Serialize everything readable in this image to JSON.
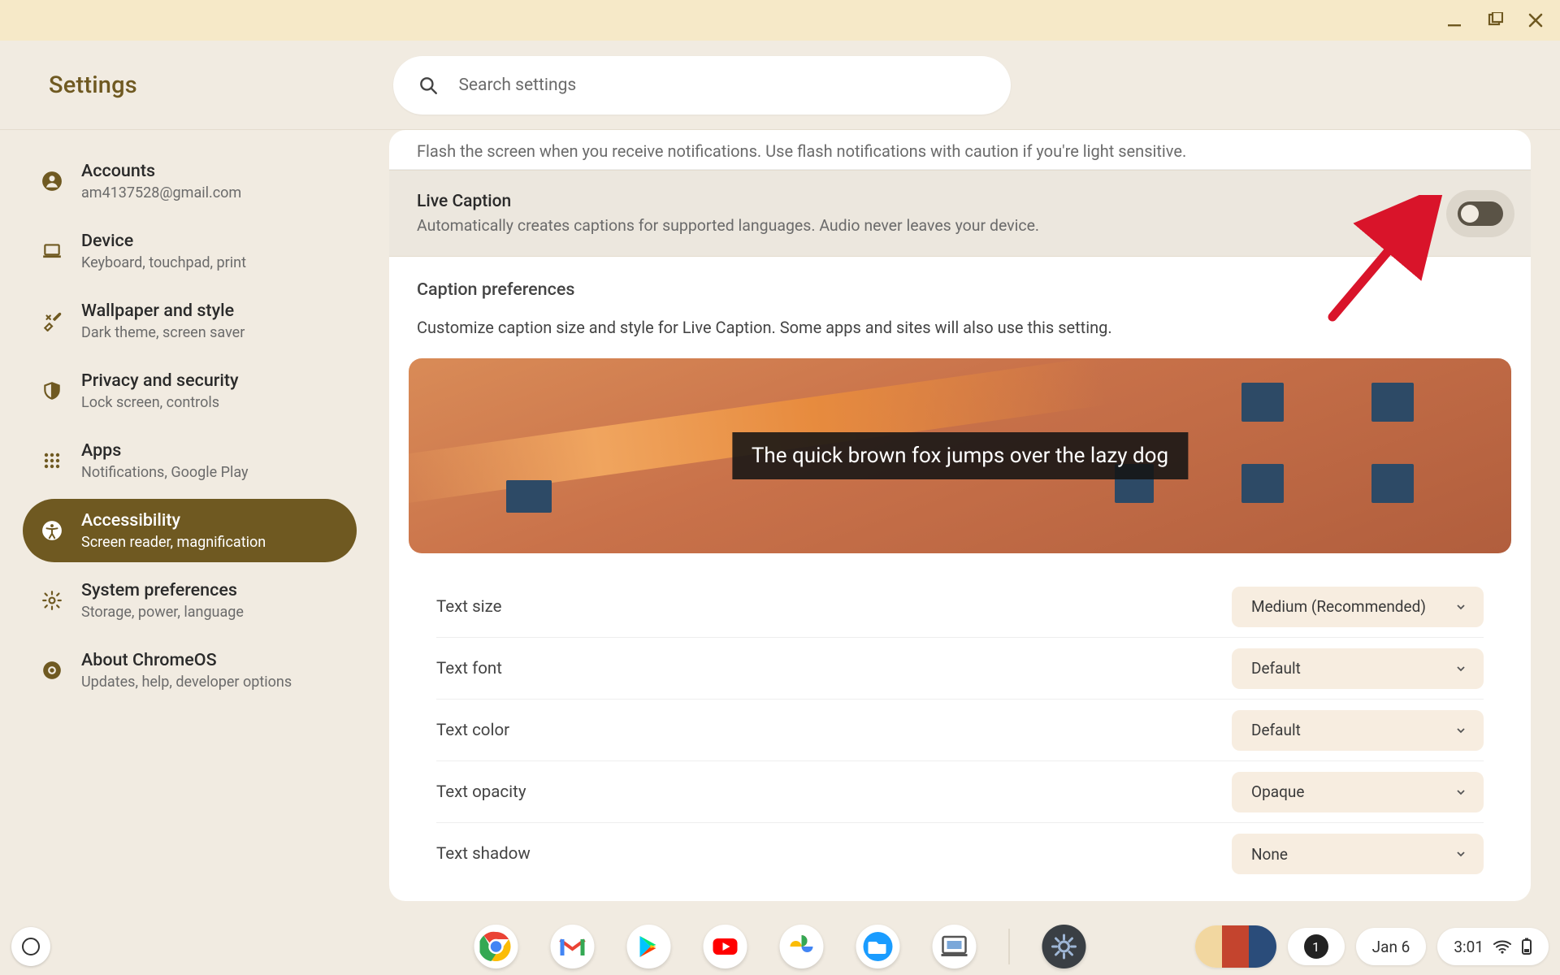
{
  "app_title": "Settings",
  "search": {
    "placeholder": "Search settings"
  },
  "window_controls": {
    "minimize": "minimize",
    "maximize": "maximize",
    "close": "close"
  },
  "sidebar": {
    "items": [
      {
        "title": "Accounts",
        "subtitle": "am4137528@gmail.com"
      },
      {
        "title": "Device",
        "subtitle": "Keyboard, touchpad, print"
      },
      {
        "title": "Wallpaper and style",
        "subtitle": "Dark theme, screen saver"
      },
      {
        "title": "Privacy and security",
        "subtitle": "Lock screen, controls"
      },
      {
        "title": "Apps",
        "subtitle": "Notifications, Google Play"
      },
      {
        "title": "Accessibility",
        "subtitle": "Screen reader, magnification"
      },
      {
        "title": "System preferences",
        "subtitle": "Storage, power, language"
      },
      {
        "title": "About ChromeOS",
        "subtitle": "Updates, help, developer options"
      }
    ]
  },
  "main": {
    "truncated_prev": "Flash the screen when you receive notifications. Use flash notifications with caution if you're light sensitive.",
    "live_caption": {
      "title": "Live Caption",
      "description": "Automatically creates captions for supported languages. Audio never leaves your device.",
      "enabled": false
    },
    "caption_prefs": {
      "heading": "Caption preferences",
      "description": "Customize caption size and style for Live Caption. Some apps and sites will also use this setting.",
      "preview_text": "The quick brown fox jumps over the lazy dog",
      "options": [
        {
          "label": "Text size",
          "value": "Medium (Recommended)"
        },
        {
          "label": "Text font",
          "value": "Default"
        },
        {
          "label": "Text color",
          "value": "Default"
        },
        {
          "label": "Text opacity",
          "value": "Opaque"
        },
        {
          "label": "Text shadow",
          "value": "None"
        }
      ]
    }
  },
  "shelf": {
    "notification_count": "1",
    "date": "Jan 6",
    "time": "3:01"
  },
  "colors": {
    "accent": "#6f5921",
    "surface": "#f1ebe1"
  }
}
